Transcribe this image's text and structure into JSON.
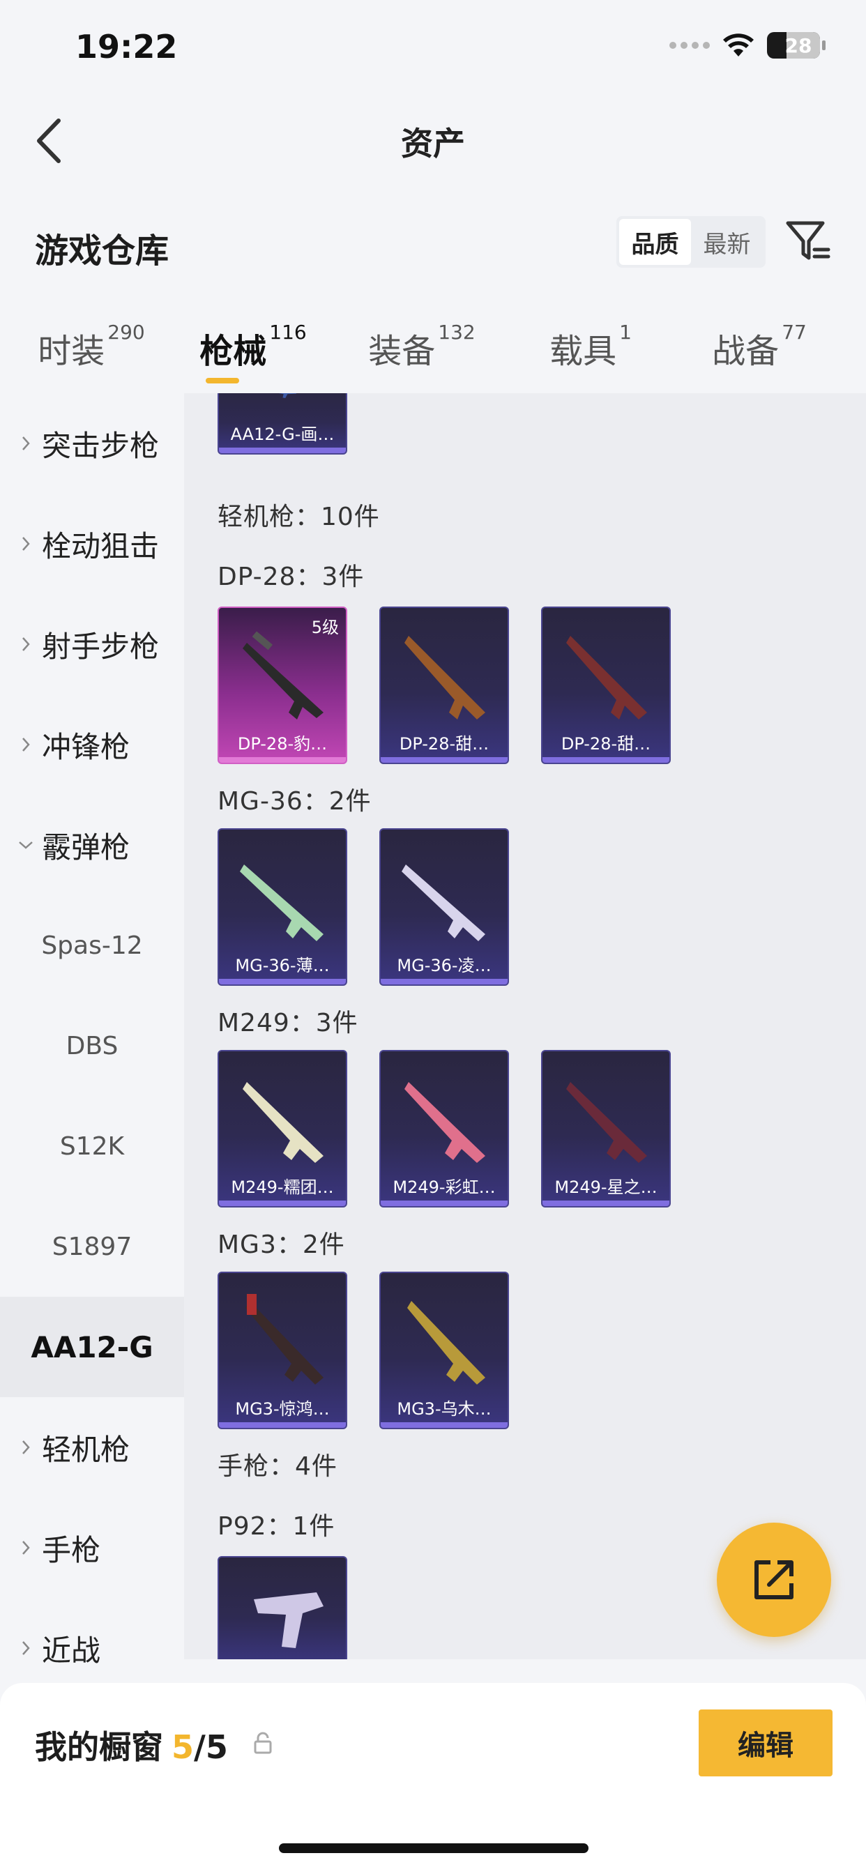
{
  "status": {
    "time": "19:22",
    "battery": "28"
  },
  "nav": {
    "title": "资产"
  },
  "header": {
    "title": "游戏仓库",
    "sort_quality": "品质",
    "sort_newest": "最新"
  },
  "tabs": [
    {
      "label": "时装",
      "count": "290"
    },
    {
      "label": "枪械",
      "count": "116"
    },
    {
      "label": "装备",
      "count": "132"
    },
    {
      "label": "载具",
      "count": "1"
    },
    {
      "label": "战备",
      "count": "77"
    }
  ],
  "sidebar": {
    "items": [
      {
        "label": "突击步枪"
      },
      {
        "label": "栓动狙击"
      },
      {
        "label": "射手步枪"
      },
      {
        "label": "冲锋枪"
      },
      {
        "label": "霰弹枪"
      },
      {
        "label": "Spas-12"
      },
      {
        "label": "DBS"
      },
      {
        "label": "S12K"
      },
      {
        "label": "S1897"
      },
      {
        "label": "AA12-G"
      },
      {
        "label": "轻机枪"
      },
      {
        "label": "手枪"
      },
      {
        "label": "近战"
      }
    ]
  },
  "content": {
    "top_card": "AA12-G-画…",
    "lmg_heading": "轻机枪：10件",
    "groups": [
      {
        "heading": "DP-28：3件",
        "cards": [
          {
            "label": "DP-28-豹…",
            "level": "5级"
          },
          {
            "label": "DP-28-甜…"
          },
          {
            "label": "DP-28-甜…"
          }
        ]
      },
      {
        "heading": "MG-36：2件",
        "cards": [
          {
            "label": "MG-36-薄…"
          },
          {
            "label": "MG-36-凌…"
          }
        ]
      },
      {
        "heading": "M249：3件",
        "cards": [
          {
            "label": "M249-糯团…"
          },
          {
            "label": "M249-彩虹…"
          },
          {
            "label": "M249-星之…"
          }
        ]
      },
      {
        "heading": "MG3：2件",
        "cards": [
          {
            "label": "MG3-惊鸿…"
          },
          {
            "label": "MG3-乌木…"
          }
        ]
      }
    ],
    "pistol_heading": "手枪：4件",
    "p92_heading": "P92：1件"
  },
  "showcase": {
    "title": "我的橱窗",
    "used": "5",
    "sep": "/",
    "total": "5",
    "edit_label": "编辑"
  },
  "colors": {
    "accent": "#f5b833",
    "card_bg": "#2e2a52",
    "card_gold": "#c247b5"
  }
}
